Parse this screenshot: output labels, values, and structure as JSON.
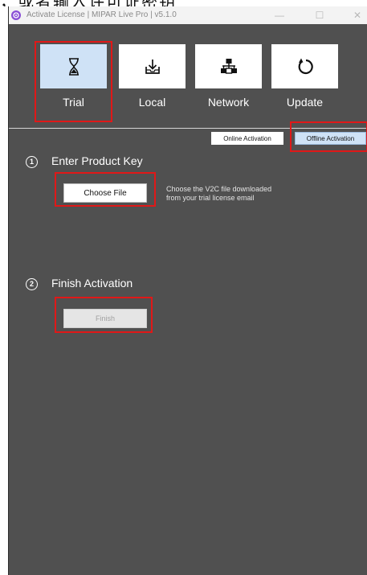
{
  "background_text": "，或者输入许可证密钥",
  "window": {
    "title": "Activate License  |  MIPAR Live Pro  |  v5.1.0",
    "controls": {
      "minimize": "—",
      "maximize": "☐",
      "close": "✕"
    }
  },
  "modes": [
    {
      "label": "Trial",
      "icon": "hourglass-icon",
      "selected": true
    },
    {
      "label": "Local",
      "icon": "download-tray-icon",
      "selected": false
    },
    {
      "label": "Network",
      "icon": "network-icon",
      "selected": false
    },
    {
      "label": "Update",
      "icon": "refresh-icon",
      "selected": false
    }
  ],
  "activation_tabs": {
    "online": "Online Activation",
    "offline": "Offline Activation",
    "selected": "offline"
  },
  "step1": {
    "number": "1",
    "title": "Enter Product Key",
    "button": "Choose File",
    "hint_line1": "Choose the V2C file downloaded",
    "hint_line2": "from your trial license email"
  },
  "step2": {
    "number": "2",
    "title": "Finish Activation",
    "button": "Finish"
  },
  "colors": {
    "panel": "#505050",
    "selected": "#cfe2f6",
    "highlight": "#e01818"
  }
}
